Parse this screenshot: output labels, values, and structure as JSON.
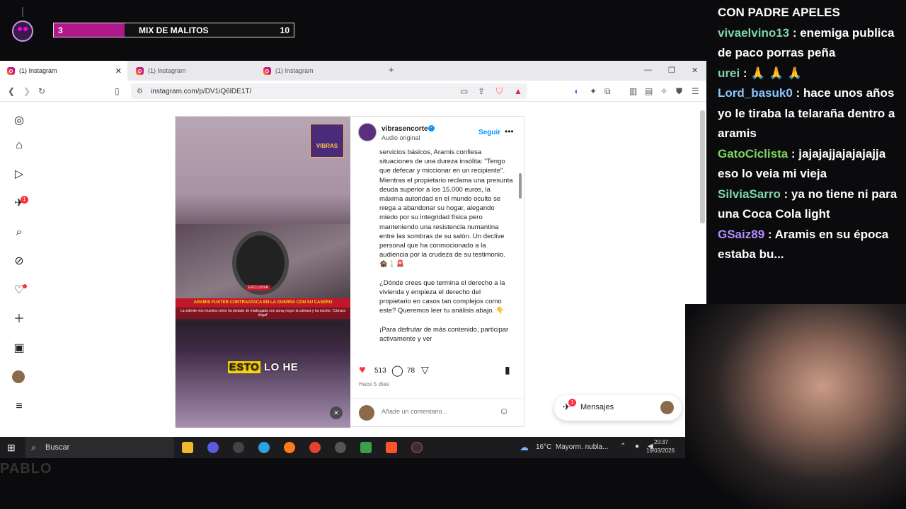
{
  "overlay": {
    "mix_number": "3",
    "mix_title": "MIX DE MALITOS",
    "mix_count": "10",
    "mix_accent": "#b0188a"
  },
  "browser": {
    "tabs": [
      {
        "label": "(1) Instagram",
        "active": true
      },
      {
        "label": "(1) Instagram",
        "active": false
      },
      {
        "label": "(1) Instagram",
        "active": false
      }
    ],
    "new_tab": "+",
    "url": "instagram.com/p/DV1iQ6lDE1T/"
  },
  "instagram": {
    "nav_icons": [
      "instagram-logo-icon",
      "home-icon",
      "reels-icon",
      "messages-icon",
      "search-icon",
      "explore-icon",
      "notifications-icon",
      "create-icon",
      "dashboard-icon",
      "profile-avatar",
      "menu-icon"
    ],
    "messages_badge": "1",
    "post": {
      "username": "vibrasencorte",
      "audio": "Audio original",
      "follow": "Seguir",
      "video_logo": "VIBRAS",
      "headline": "ARAMIS FUSTER CONTRAATACA EN LA GUERRA CON SU CASERO",
      "subline": "La vidente nos muestra cómo ha pintado de madrugada con spray negro la cámara y ha escrito: 'Cámara ilegal'",
      "exclusive_tag": "EXCLUSIVA",
      "subtitle_yellow": "ESTO",
      "subtitle_rest": " LO HE",
      "caption": "servicios básicos, Aramis confiesa situaciones de una dureza insólita: \"Tengo que defecar y miccionar en un recipiente\". Mientras el propietario reclama una presunta deuda superior a los 15.000 euros, la máxima autoridad en el mundo oculto se niega a abandonar su hogar, alegando miedo por su integridad física pero manteniendo una resistencia numantina entre las sombras de su salón. Un declive personal que ha conmocionado a la audiencia por la crudeza de su testimonio. 🏚️🕯️🚨\n\n¿Dónde crees que termina el derecho a la vivienda y empieza el derecho del propietario en casos tan complejos como este? Queremos leer tu análisis abajo. 👇\n\n¡Para disfrutar de más contenido, participar activamente y ver",
      "likes": "513",
      "comments": "78",
      "time": "Hace 5 días",
      "comment_placeholder": "Añade un comentario..."
    },
    "messages_button": "Mensajes",
    "messages_button_badge": "1"
  },
  "taskbar": {
    "search": "Buscar",
    "weather": "16°C  Mayorm. nubla...",
    "time": "20:37",
    "date": "19/03/2026"
  },
  "chat": {
    "title": "CON PADRE APELES",
    "messages": [
      {
        "user": "vivaelvino13",
        "text": "enemiga publica de paco porras peña",
        "color": "#7cd7a7"
      },
      {
        "user": "urei",
        "text": "🙏 🙏 🙏",
        "color": "#7cd7a7"
      },
      {
        "user": "Lord_basuk0",
        "text": "hace unos años yo le tiraba la telaraña dentro a aramis",
        "color": "#8cc4ff"
      },
      {
        "user": "GatoCiclista",
        "text": "jajajajjajajajajja eso lo veia mi vieja",
        "color": "#7cd75a"
      },
      {
        "user": "SilviaSarro",
        "text": "ya no tiene ni para una Coca Cola light",
        "color": "#7cd7a7"
      },
      {
        "user": "GSaiz89",
        "text": "Aramis en su época estaba bu...",
        "color": "#b58cff"
      }
    ]
  },
  "watermark": "PABLO"
}
